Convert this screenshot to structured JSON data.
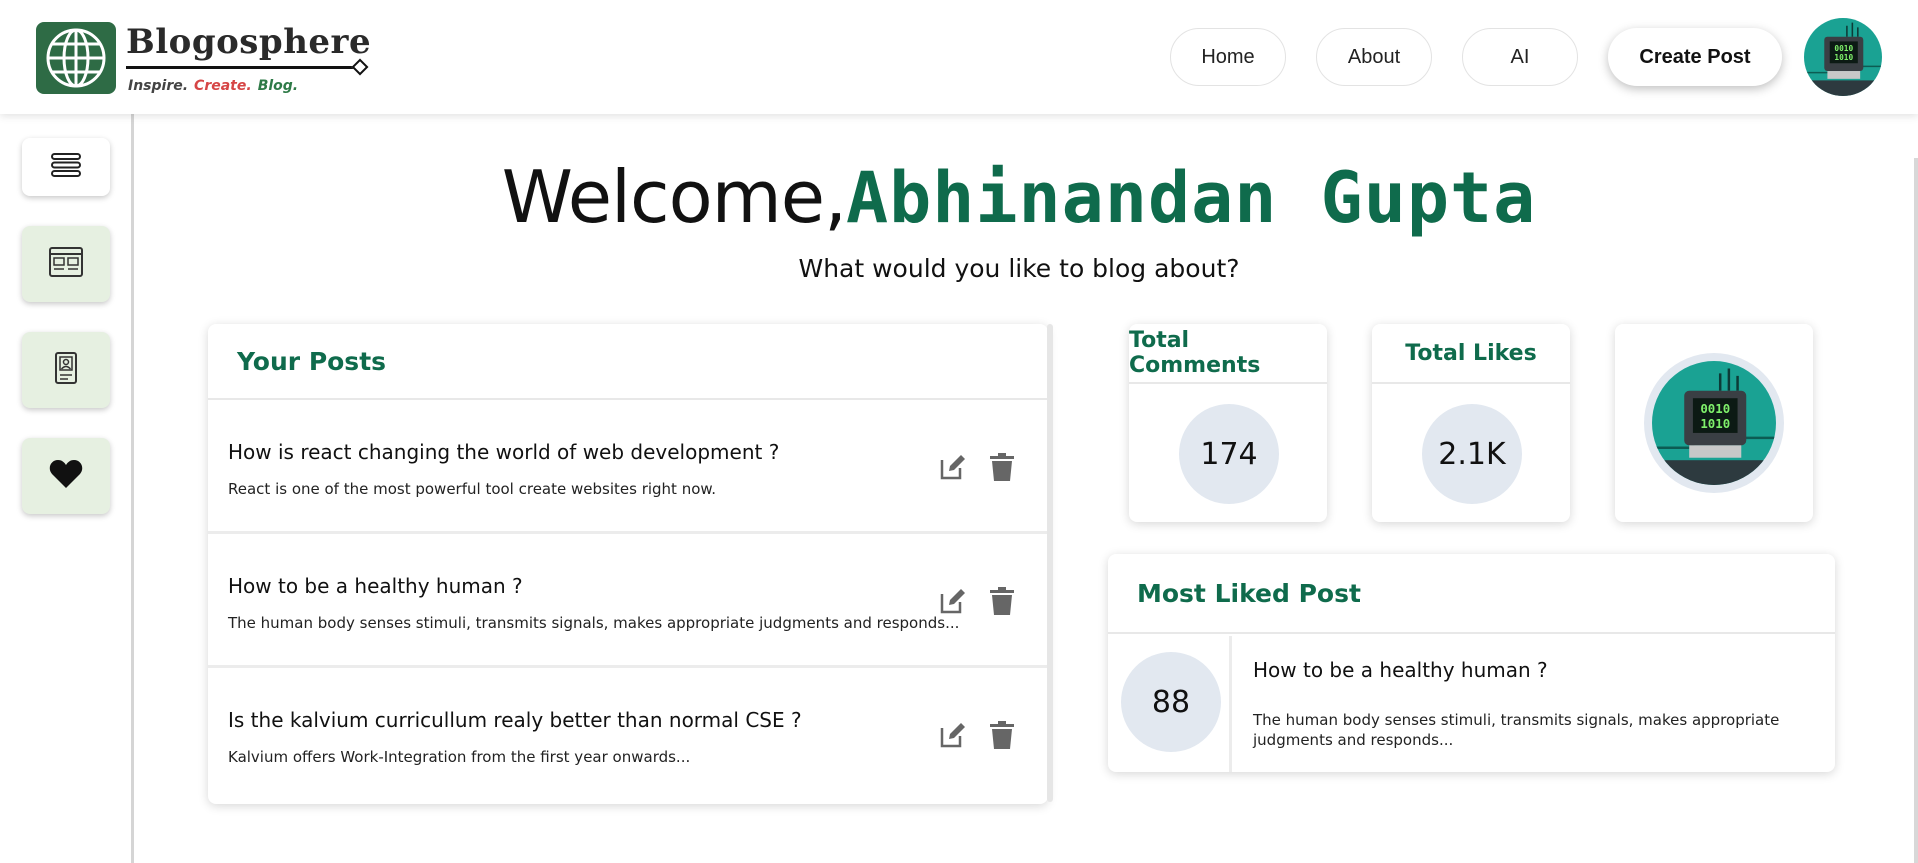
{
  "header": {
    "brand": "Blogosphere",
    "tagline": [
      "Inspire.",
      "Create.",
      "Blog."
    ],
    "nav": {
      "home": "Home",
      "about": "About",
      "ai": "AI",
      "create_post": "Create Post"
    }
  },
  "colors": {
    "accent_green": "#0f6b4c",
    "sidebar_tint": "#e6f0e1",
    "stat_circle": "#e2e8f0"
  },
  "sidebar": {
    "items": [
      {
        "icon": "menu-icon"
      },
      {
        "icon": "posts-icon"
      },
      {
        "icon": "profile-icon"
      },
      {
        "icon": "heart-icon"
      }
    ]
  },
  "welcome": {
    "greeting": "Welcome,",
    "name": "Abhinandan Gupta",
    "subtitle": "What would you like to blog about?"
  },
  "posts": {
    "title": "Your Posts",
    "items": [
      {
        "title": "How is react changing the world of web development ?",
        "excerpt": "React is one of the most powerful tool create websites right now."
      },
      {
        "title": "How to be a healthy human ?",
        "excerpt": "The human body senses stimuli, transmits signals, makes appropriate judgments and responds..."
      },
      {
        "title": "Is the kalvium curricullum realy better than normal CSE ?",
        "excerpt": "Kalvium offers Work-Integration from the first year onwards..."
      }
    ]
  },
  "stats": {
    "comments_label": "Total Comments",
    "comments_value": "174",
    "likes_label": "Total Likes",
    "likes_value": "2.1K"
  },
  "most_liked": {
    "title": "Most Liked Post",
    "likes": "88",
    "post_title": "How to be a healthy human ?",
    "post_excerpt": "The human body senses stimuli, transmits signals, makes appropriate judgments and responds..."
  }
}
